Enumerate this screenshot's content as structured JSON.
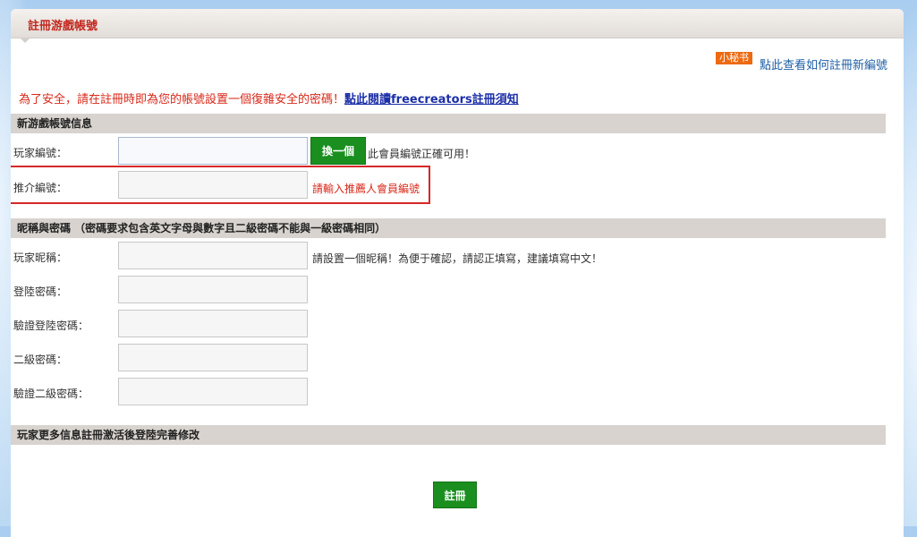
{
  "header": {
    "title": "註冊游戲帳號"
  },
  "tip": {
    "badge": "小秘书",
    "link": "點此查看如何註冊新編號"
  },
  "notice": {
    "text": "為了安全，請在註冊時即為您的帳號設置一個復雜安全的密碼！",
    "link": "點此閱讀freecreators註冊須知"
  },
  "sections": {
    "account": "新游戲帳號信息",
    "password": "昵稱與密碼 （密碼要求包含英文字母與數字且二級密碼不能與一級密碼相同）",
    "more": "玩家更多信息註冊激活後登陸完善修改"
  },
  "fields": {
    "player_id": {
      "label": "玩家編號：",
      "value": ""
    },
    "referral_id": {
      "label": "推介編號：",
      "value": ""
    },
    "nickname": {
      "label": "玩家昵稱：",
      "value": ""
    },
    "login_password": {
      "label": "登陸密碼：",
      "value": ""
    },
    "confirm_login_password": {
      "label": "驗證登陸密碼：",
      "value": ""
    },
    "second_password": {
      "label": "二級密碼：",
      "value": ""
    },
    "confirm_second_password": {
      "label": "驗證二級密碼：",
      "value": ""
    }
  },
  "buttons": {
    "change": "換一個",
    "register": "註冊"
  },
  "hints": {
    "player_id": "此會員編號正確可用！",
    "referral_id": "請輸入推薦人會員編號",
    "nickname": "請設置一個昵稱！為便于確認，請認正填寫，建議填寫中文！"
  }
}
